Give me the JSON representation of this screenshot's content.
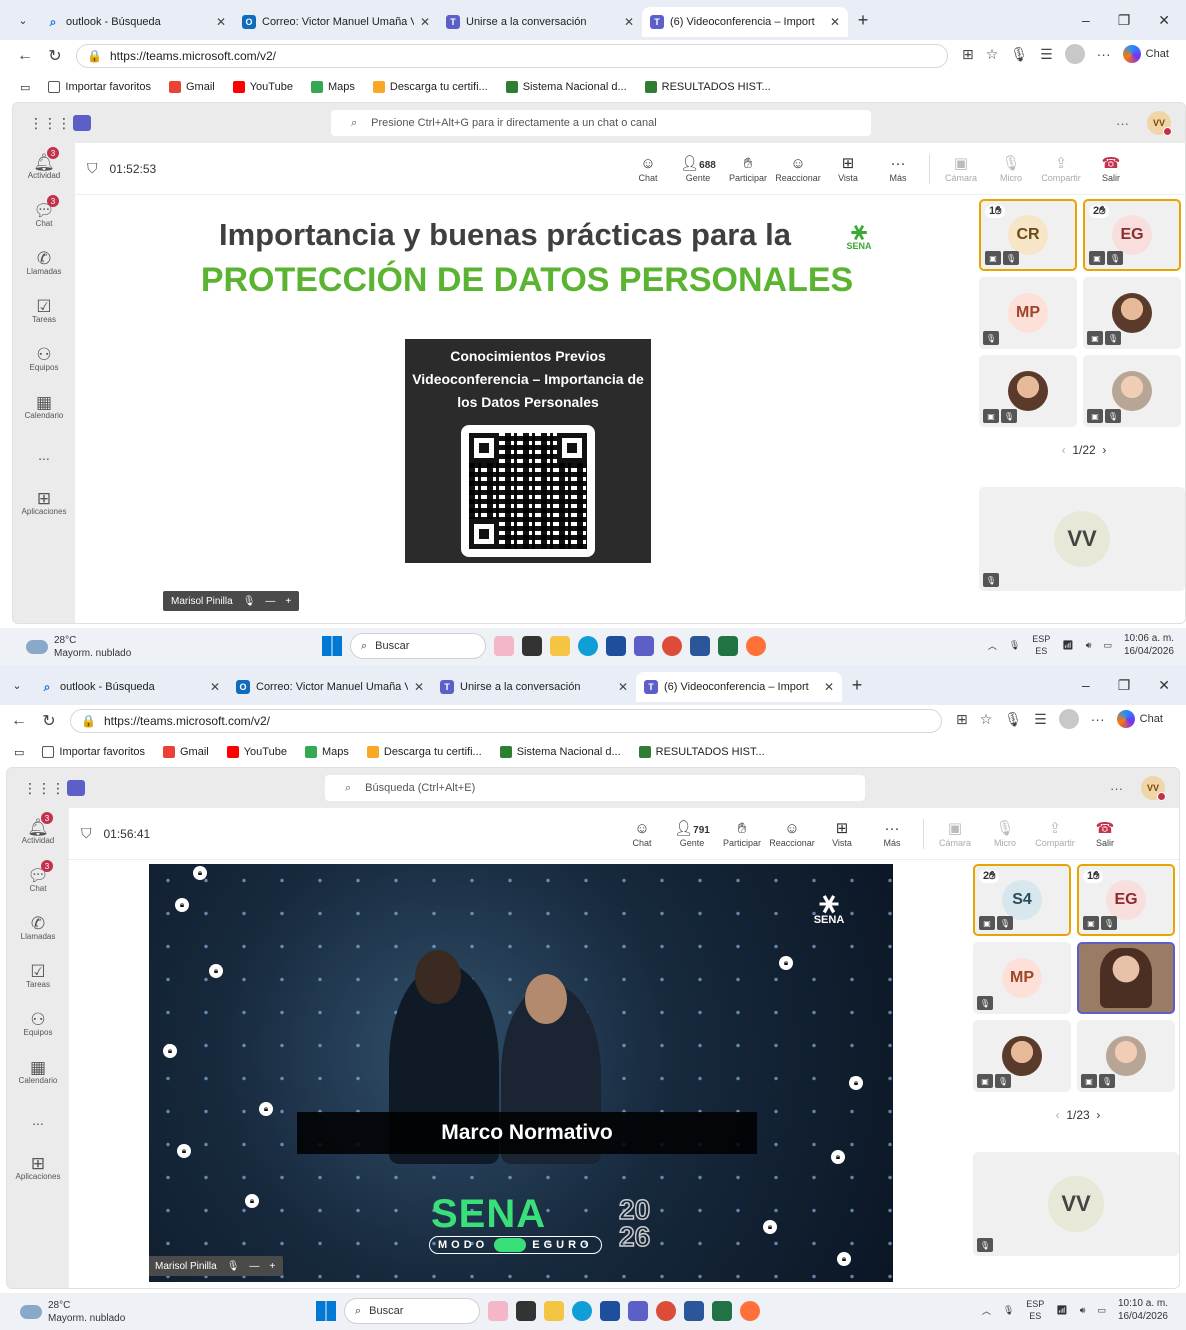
{
  "screens": [
    {
      "browser": {
        "tabs": [
          {
            "label": "outlook - Búsqueda"
          },
          {
            "label": "Correo: Victor Manuel Umaña Villa"
          },
          {
            "label": "Unirse a la conversación"
          },
          {
            "label": "(6) Videoconferencia – Import"
          }
        ],
        "url": "https://teams.microsoft.com/v2/",
        "copilot_label": "Chat",
        "bookmarks": [
          "Importar favoritos",
          "Gmail",
          "YouTube",
          "Maps",
          "Descarga tu certifi...",
          "Sistema Nacional d...",
          "RESULTADOS HIST..."
        ]
      },
      "teams": {
        "search_placeholder": "Presione Ctrl+Alt+G para ir directamente a un chat o canal",
        "me_initials": "VV",
        "rail": [
          {
            "label": "Actividad",
            "badge": "3"
          },
          {
            "label": "Chat",
            "badge": "3"
          },
          {
            "label": "Llamadas"
          },
          {
            "label": "Tareas"
          },
          {
            "label": "Equipos"
          },
          {
            "label": "Calendario"
          },
          {
            "label": "..."
          },
          {
            "label": "Aplicaciones"
          }
        ],
        "timer": "01:52:53",
        "controls": {
          "chat": "Chat",
          "people": "Gente",
          "people_count": "688",
          "raise": "Participar",
          "react": "Reaccionar",
          "view": "Vista",
          "more": "Más",
          "camera": "Cámara",
          "mic": "Micro",
          "share": "Compartir",
          "leave": "Salir"
        },
        "slide": {
          "title": "Importancia y buenas prácticas para la",
          "subtitle": "PROTECCIÓN DE DATOS PERSONALES",
          "logo_text": "SENA",
          "qr_text": "Conocimientos Previos Videoconferencia – Importancia de los Datos Personales"
        },
        "presenter": "Marisol Pinilla",
        "tiles": [
          {
            "initials": "CR",
            "hand": "1"
          },
          {
            "initials": "EG",
            "hand": "2"
          },
          {
            "initials": "MP"
          },
          {
            "photo": true
          },
          {
            "photo": true
          },
          {
            "photo": true
          }
        ],
        "pager": "1/22",
        "self_initials": "VV"
      },
      "taskbar": {
        "temp": "28°C",
        "weather": "Mayorm. nublado",
        "search": "Buscar",
        "lang1": "ESP",
        "lang2": "ES",
        "time": "10:06 a. m.",
        "date": "16/04/2026"
      }
    },
    {
      "browser": {
        "tabs": [
          {
            "label": "outlook - Búsqueda"
          },
          {
            "label": "Correo: Victor Manuel Umaña Villa"
          },
          {
            "label": "Unirse a la conversación"
          },
          {
            "label": "(6) Videoconferencia – Import"
          }
        ],
        "url": "https://teams.microsoft.com/v2/",
        "copilot_label": "Chat",
        "bookmarks": [
          "Importar favoritos",
          "Gmail",
          "YouTube",
          "Maps",
          "Descarga tu certifi...",
          "Sistema Nacional d...",
          "RESULTADOS HIST..."
        ]
      },
      "teams": {
        "search_placeholder": "Búsqueda (Ctrl+Alt+E)",
        "me_initials": "VV",
        "rail": [
          {
            "label": "Actividad",
            "badge": "3"
          },
          {
            "label": "Chat",
            "badge": "3"
          },
          {
            "label": "Llamadas"
          },
          {
            "label": "Tareas"
          },
          {
            "label": "Equipos"
          },
          {
            "label": "Calendario"
          },
          {
            "label": "..."
          },
          {
            "label": "Aplicaciones"
          }
        ],
        "timer": "01:56:41",
        "controls": {
          "chat": "Chat",
          "people": "Gente",
          "people_count": "791",
          "raise": "Participar",
          "react": "Reaccionar",
          "view": "Vista",
          "more": "Más",
          "camera": "Cámara",
          "mic": "Micro",
          "share": "Compartir",
          "leave": "Salir"
        },
        "slide": {
          "banner": "Marco Normativo",
          "brand": "SENA",
          "year_top": "20",
          "year_bottom": "26",
          "modo_left": "MODO",
          "modo_right": "EGURO",
          "logo_text": "SENA"
        },
        "presenter": "Marisol Pinilla",
        "tiles": [
          {
            "initials": "S4",
            "hand": "2"
          },
          {
            "initials": "EG",
            "hand": "1"
          },
          {
            "initials": "MP"
          },
          {
            "photo": true
          },
          {
            "photo": true
          },
          {
            "photo": true
          }
        ],
        "pager": "1/23",
        "self_initials": "VV"
      },
      "taskbar": {
        "temp": "28°C",
        "weather": "Mayorm. nublado",
        "search": "Buscar",
        "lang1": "ESP",
        "lang2": "ES",
        "time": "10:10 a. m.",
        "date": "16/04/2026"
      }
    }
  ],
  "colors": {
    "teams_purple": "#5b5fc7",
    "hand_gold": "#e8a400",
    "leave_red": "#c4314b",
    "sena_green": "#39a935"
  },
  "icons": [
    "search-icon",
    "outlook-icon",
    "teams-icon",
    "close-icon",
    "plus-icon",
    "back-icon",
    "refresh-icon",
    "lock-icon",
    "star-icon",
    "mic-icon",
    "waffle-icon",
    "shield-icon",
    "people-icon",
    "hand-icon",
    "emoji-icon",
    "grid-icon",
    "more-icon",
    "camera-icon",
    "share-icon",
    "phone-icon",
    "bell-icon",
    "chat-icon",
    "calendar-icon",
    "windows-icon"
  ]
}
